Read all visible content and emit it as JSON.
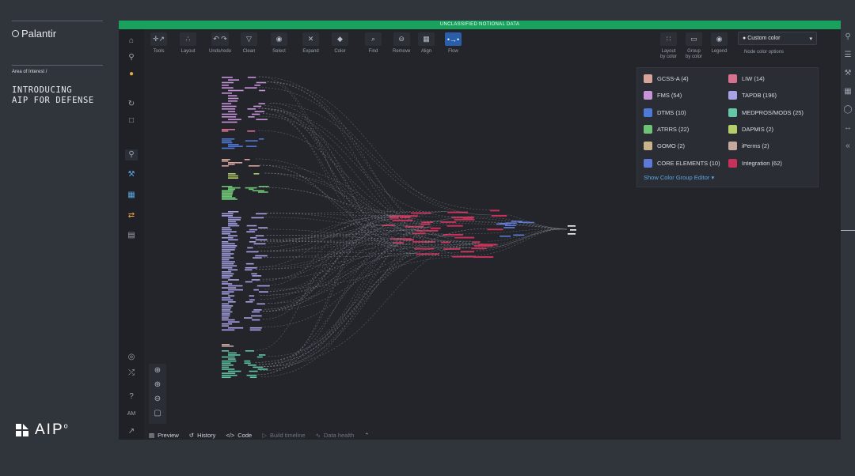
{
  "slide": {
    "brand": "Palantir",
    "crumb": "Area of Interest /",
    "title_line1": "INTRODUCING",
    "title_line2": "AIP FOR DEFENSE",
    "logo_text": "AIP",
    "logo_sup": "o"
  },
  "banner": "UNCLASSIFIED NOTIONAL DATA",
  "toolbar": {
    "tools": [
      {
        "label": "Tools",
        "icon": "✛↗"
      },
      {
        "label": "Layout",
        "icon": "∴"
      },
      {
        "label": "Undo/redo",
        "icon": "↶ ↷"
      },
      {
        "label": "Clean",
        "icon": "▽"
      },
      {
        "label": "Select",
        "icon": "◉"
      },
      {
        "label": "Expand",
        "icon": "✕"
      },
      {
        "label": "Color",
        "icon": "◆"
      },
      {
        "label": "Find",
        "icon": "⌕"
      },
      {
        "label": "Remove",
        "icon": "⊖"
      },
      {
        "label": "Align",
        "icon": "▦"
      },
      {
        "label": "Flow",
        "icon": "•→•"
      }
    ],
    "right": [
      {
        "label": "Layout by color",
        "l1": "Layout",
        "l2": "by color",
        "icon": "∷"
      },
      {
        "label": "Group by color",
        "l1": "Group",
        "l2": "by color",
        "icon": "▭"
      },
      {
        "label": "Legend",
        "l1": "Legend",
        "l2": "",
        "icon": "◉"
      }
    ],
    "color_select": "Custom color",
    "color_sub": "Node color options"
  },
  "legend": {
    "items": [
      {
        "label": "GCSS-A (4)",
        "color": "#d8a398"
      },
      {
        "label": "LIW (14)",
        "color": "#d5738f"
      },
      {
        "label": "FMS (54)",
        "color": "#c793d9"
      },
      {
        "label": "TAPDB (196)",
        "color": "#a8a2e6"
      },
      {
        "label": "DTMS (10)",
        "color": "#4f79d6"
      },
      {
        "label": "MEDPROS/MODS (25)",
        "color": "#63c8a6"
      },
      {
        "label": "ATRRS (22)",
        "color": "#6dc274"
      },
      {
        "label": "DAPMIS (2)",
        "color": "#b5cd6b"
      },
      {
        "label": "GOMO (2)",
        "color": "#c9b38a"
      },
      {
        "label": "iPerms (2)",
        "color": "#c4a99f"
      },
      {
        "label": "CORE ELEMENTS (10)",
        "color": "#5e7ad8"
      },
      {
        "label": "Integration (62)",
        "color": "#c83159"
      }
    ],
    "editor_link": "Show Color Group Editor ▾"
  },
  "bottom": [
    {
      "label": "Preview",
      "icon": "▤",
      "dim": false
    },
    {
      "label": "History",
      "icon": "↺",
      "dim": false
    },
    {
      "label": "Code",
      "icon": "</>",
      "dim": false
    },
    {
      "label": "Build timeline",
      "icon": "▷",
      "dim": true
    },
    {
      "label": "Data health",
      "icon": "∿",
      "dim": true
    }
  ],
  "left_rail_text": "AM"
}
